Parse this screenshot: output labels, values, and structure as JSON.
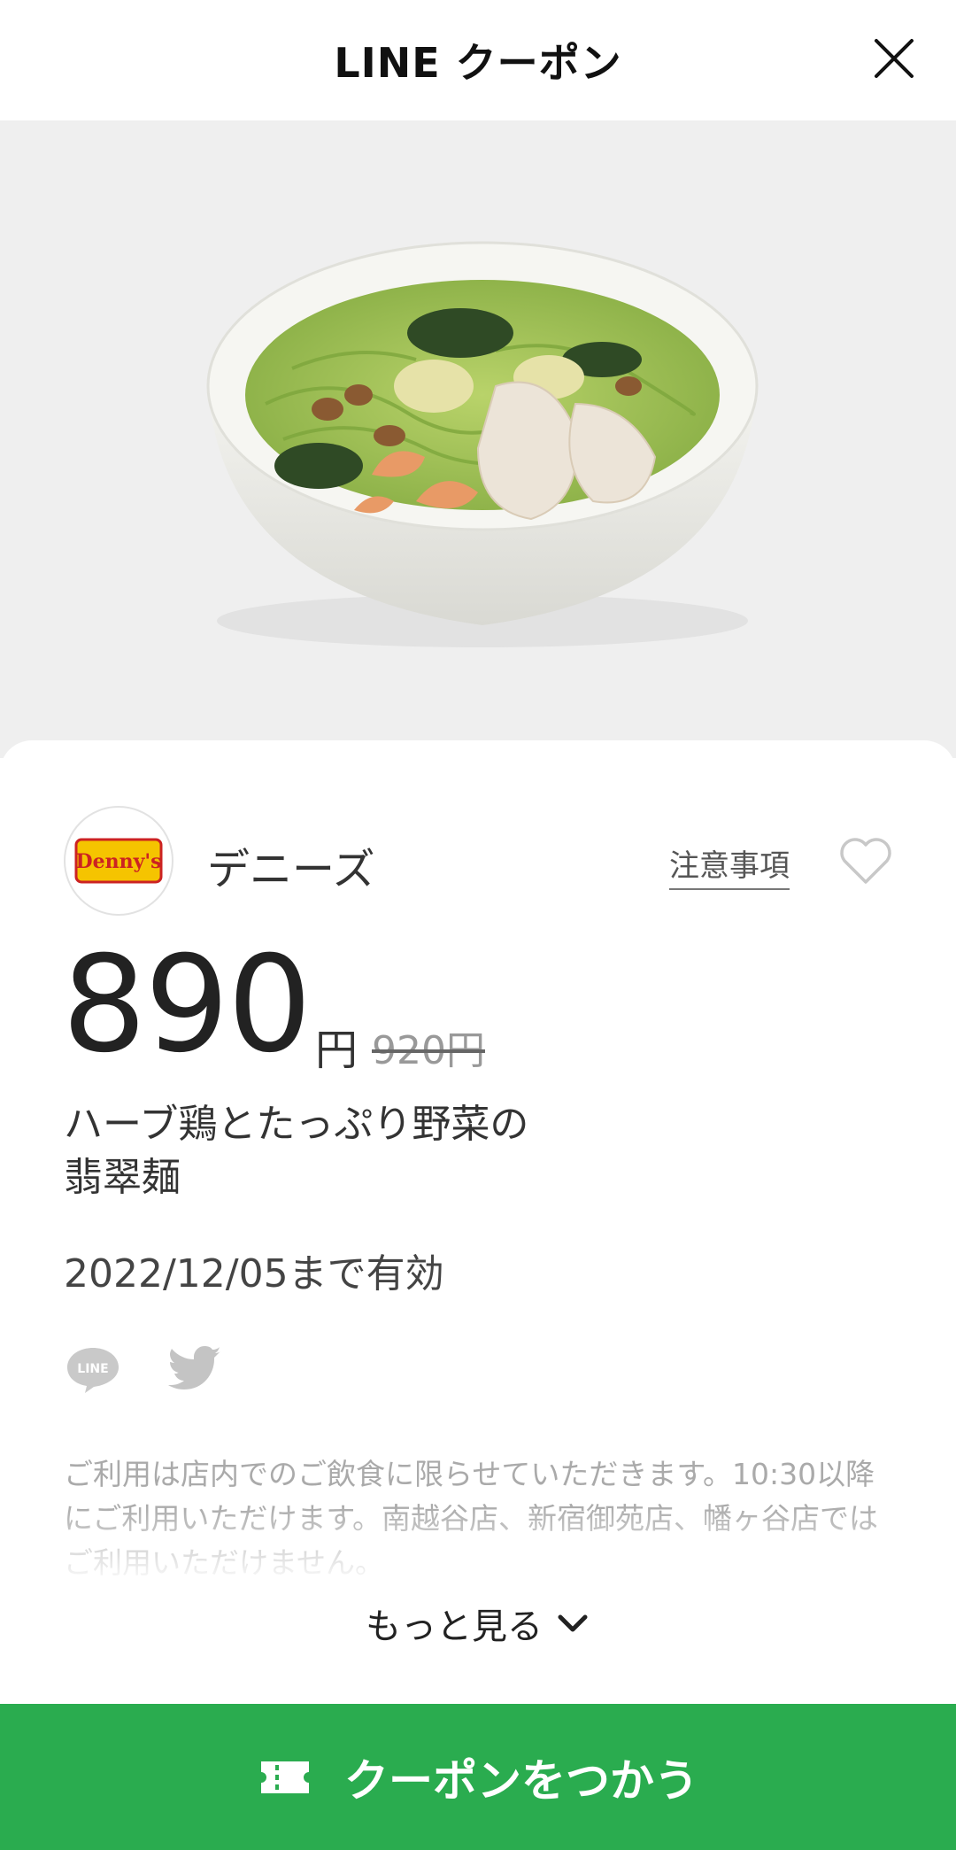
{
  "header": {
    "title": "LINE クーポン",
    "close_icon": "close-icon"
  },
  "hero": {
    "image": "green-noodle-soup-bowl"
  },
  "store": {
    "name": "デニーズ",
    "logo_text": "Denny's",
    "notes_label": "注意事項",
    "favorite_icon": "heart-icon"
  },
  "coupon": {
    "price": "890",
    "currency": "円",
    "original_price": "920円",
    "product_name_line1": "ハーブ鶏とたっぷり野菜の",
    "product_name_line2": "翡翠麺",
    "validity": "2022/12/05まで有効"
  },
  "share": {
    "line_label": "LINE",
    "twitter_icon": "twitter-icon"
  },
  "description": "ご利用は店内でのご飲食に限らせていただきます。10:30以降にご利用いただけます。南越谷店、新宿御苑店、幡ヶ谷店ではご利用いただけません。",
  "more_label": "もっと見る",
  "use_button": {
    "label": "クーポンをつかう",
    "icon": "ticket-icon"
  },
  "colors": {
    "accent": "#2aac4f",
    "background": "#efefef"
  }
}
